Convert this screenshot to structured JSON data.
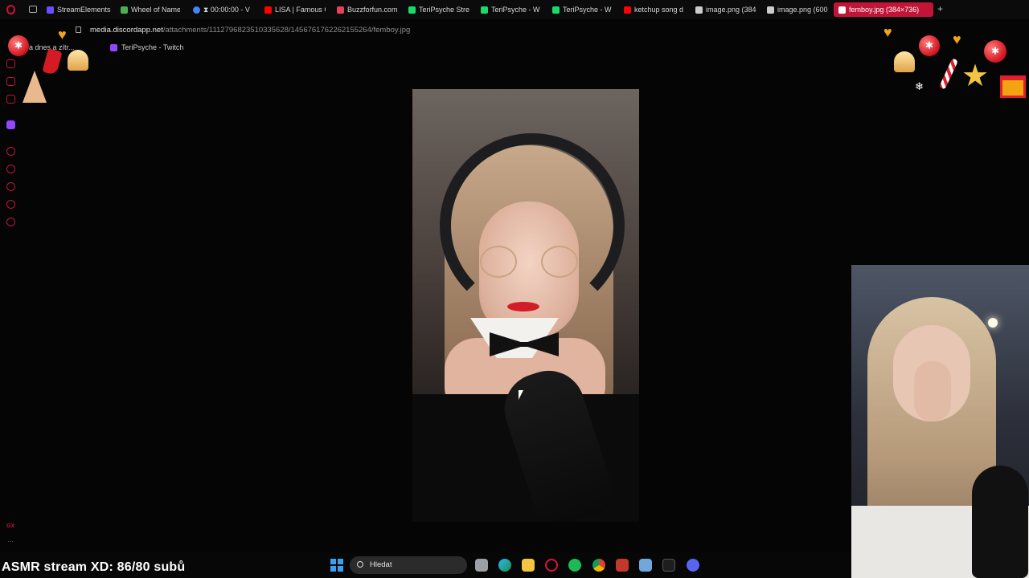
{
  "tabs": [
    {
      "label": "StreamElements",
      "color": "#6b4cff",
      "active": false
    },
    {
      "label": "Wheel of Names",
      "color": "#4caf50",
      "active": false
    },
    {
      "label": "⧗ 00:00:00 - V",
      "color": "#4285f4",
      "active": false
    },
    {
      "label": "LISA | Famous C",
      "color": "#ff0000",
      "active": false
    },
    {
      "label": "Buzzforfun.com",
      "color": "#e4405f",
      "active": false
    },
    {
      "label": "TeriPsyche Stre",
      "color": "#1bd96a",
      "active": false
    },
    {
      "label": "TeriPsyche - W",
      "color": "#1bd96a",
      "active": false
    },
    {
      "label": "TeriPsyche - W",
      "color": "#1bd96a",
      "active": false
    },
    {
      "label": "ketchup song d",
      "color": "#ff0000",
      "active": false
    },
    {
      "label": "image.png (384",
      "color": "#cccccc",
      "active": false
    },
    {
      "label": "image.png (600",
      "color": "#cccccc",
      "active": false
    },
    {
      "label": "femboy.jpg (384×736)",
      "color": "#ffffff",
      "active": true
    }
  ],
  "address": {
    "domain": "media.discordapp.net",
    "path": "/attachments/1112796823510335628/1456761762262155264/femboy.jpg"
  },
  "bookmarks": [
    {
      "label": "a dnes a zítr..."
    },
    {
      "label": "TeriPsyche - Twitch"
    }
  ],
  "viewer": {
    "alt_label": "femboy.jpg"
  },
  "overlay_text": "ASMR stream XD: 86/80 subů",
  "taskbar": {
    "search_label": "Hledat",
    "apps": [
      "task-view-icon",
      "edge-icon",
      "file-explorer-icon",
      "opera-gx-icon",
      "spotify-icon",
      "chrome-icon",
      "calendar-icon",
      "notepad-icon",
      "terminal-icon",
      "discord-icon"
    ]
  },
  "colors": {
    "accent": "#c21437",
    "background": "#050505"
  }
}
